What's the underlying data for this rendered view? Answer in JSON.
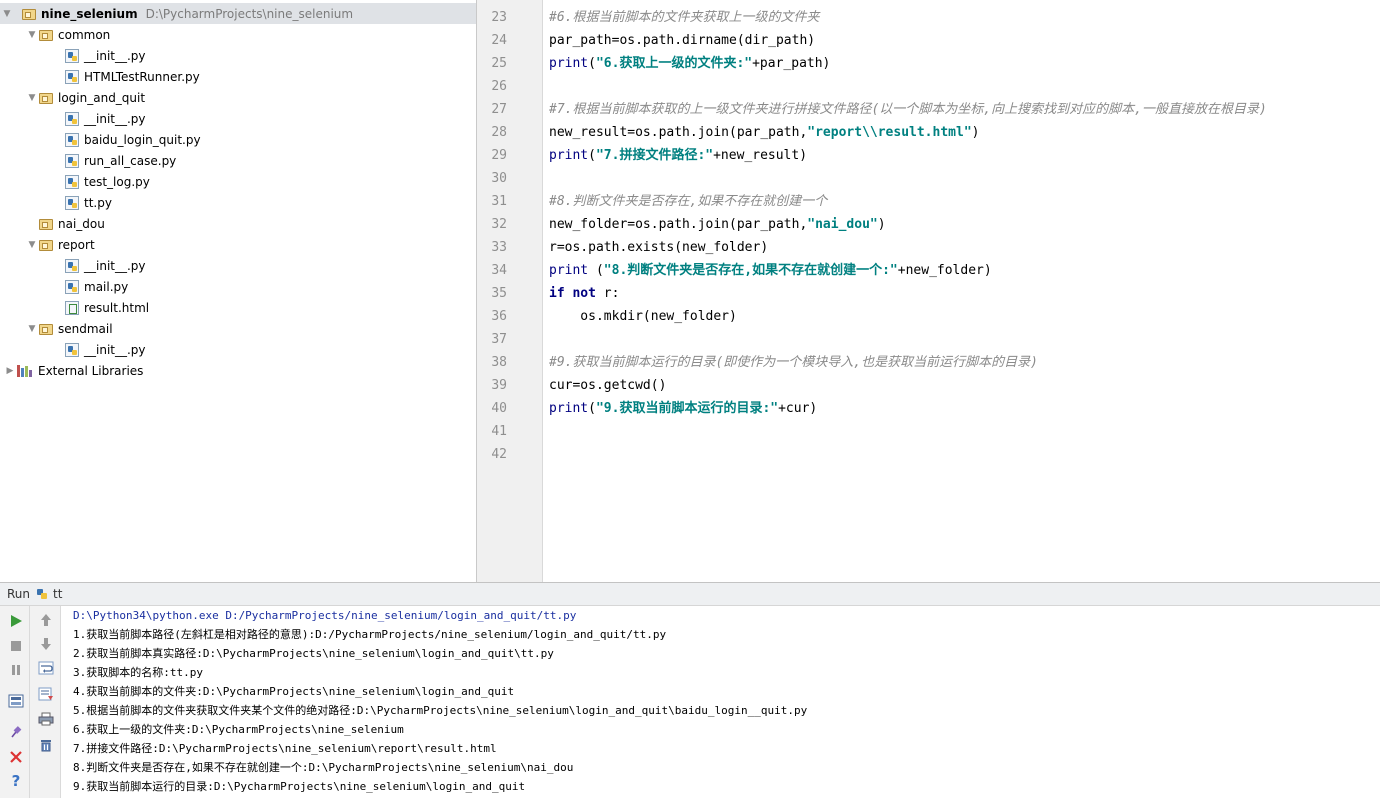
{
  "project_tree": {
    "root": {
      "name": "nine_selenium",
      "path": "D:\\PycharmProjects\\nine_selenium"
    },
    "items": [
      {
        "label": "common",
        "type": "folder",
        "depth": 1,
        "expanded": true
      },
      {
        "label": "__init__.py",
        "type": "py",
        "depth": 2
      },
      {
        "label": "HTMLTestRunner.py",
        "type": "py",
        "depth": 2
      },
      {
        "label": "login_and_quit",
        "type": "folder",
        "depth": 1,
        "expanded": true
      },
      {
        "label": "__init__.py",
        "type": "py",
        "depth": 2
      },
      {
        "label": "baidu_login_quit.py",
        "type": "py",
        "depth": 2
      },
      {
        "label": "run_all_case.py",
        "type": "py",
        "depth": 2
      },
      {
        "label": "test_log.py",
        "type": "py",
        "depth": 2
      },
      {
        "label": "tt.py",
        "type": "py",
        "depth": 2
      },
      {
        "label": "nai_dou",
        "type": "folder",
        "depth": 1,
        "expanded": false
      },
      {
        "label": "report",
        "type": "folder",
        "depth": 1,
        "expanded": true
      },
      {
        "label": "__init__.py",
        "type": "py",
        "depth": 2
      },
      {
        "label": "mail.py",
        "type": "py",
        "depth": 2
      },
      {
        "label": "result.html",
        "type": "html",
        "depth": 2
      },
      {
        "label": "sendmail",
        "type": "folder",
        "depth": 1,
        "expanded": true
      },
      {
        "label": "__init__.py",
        "type": "py",
        "depth": 2
      },
      {
        "label": "External Libraries",
        "type": "lib",
        "depth": 0,
        "expanded": false
      }
    ]
  },
  "editor": {
    "lines": [
      {
        "num": "23",
        "tokens": [
          {
            "t": "#6.根据当前脚本的文件夹获取上一级的文件夹",
            "c": "cm"
          }
        ]
      },
      {
        "num": "24",
        "tokens": [
          {
            "t": "par_path=os.path.dirname(dir_path)",
            "c": "ident"
          }
        ]
      },
      {
        "num": "25",
        "tokens": [
          {
            "t": "print",
            "c": "bi"
          },
          {
            "t": "(",
            "c": "ident"
          },
          {
            "t": "\"6.获取上一级的文件夹:\"",
            "c": "str"
          },
          {
            "t": "+par_path)",
            "c": "ident"
          }
        ]
      },
      {
        "num": "26",
        "tokens": []
      },
      {
        "num": "27",
        "tokens": [
          {
            "t": "#7.根据当前脚本获取的上一级文件夹进行拼接文件路径(以一个脚本为坐标,向上搜索找到对应的脚本,一般直接放在根目录)",
            "c": "cm"
          }
        ]
      },
      {
        "num": "28",
        "tokens": [
          {
            "t": "new_result=os.path.join(par_path,",
            "c": "ident"
          },
          {
            "t": "\"report\\\\result.html\"",
            "c": "str"
          },
          {
            "t": ")",
            "c": "ident"
          }
        ]
      },
      {
        "num": "29",
        "tokens": [
          {
            "t": "print",
            "c": "bi"
          },
          {
            "t": "(",
            "c": "ident"
          },
          {
            "t": "\"7.拼接文件路径:\"",
            "c": "str"
          },
          {
            "t": "+new_result)",
            "c": "ident"
          }
        ]
      },
      {
        "num": "30",
        "tokens": []
      },
      {
        "num": "31",
        "tokens": [
          {
            "t": "#8.判断文件夹是否存在,如果不存在就创建一个",
            "c": "cm"
          }
        ]
      },
      {
        "num": "32",
        "tokens": [
          {
            "t": "new_folder=os.path.join(par_path,",
            "c": "ident"
          },
          {
            "t": "\"nai_dou\"",
            "c": "str"
          },
          {
            "t": ")",
            "c": "ident"
          }
        ]
      },
      {
        "num": "33",
        "tokens": [
          {
            "t": "r=os.path.exists(new_folder)",
            "c": "ident"
          }
        ]
      },
      {
        "num": "34",
        "tokens": [
          {
            "t": "print",
            "c": "bi"
          },
          {
            "t": " (",
            "c": "ident"
          },
          {
            "t": "\"8.判断文件夹是否存在,如果不存在就创建一个:\"",
            "c": "str"
          },
          {
            "t": "+new_folder)",
            "c": "ident"
          }
        ]
      },
      {
        "num": "35",
        "tokens": [
          {
            "t": "if",
            "c": "kw"
          },
          {
            "t": " ",
            "c": "ident"
          },
          {
            "t": "not",
            "c": "kw"
          },
          {
            "t": " r:",
            "c": "ident"
          }
        ]
      },
      {
        "num": "36",
        "tokens": [
          {
            "t": "    os.mkdir(new_folder)",
            "c": "ident"
          }
        ]
      },
      {
        "num": "37",
        "tokens": []
      },
      {
        "num": "38",
        "tokens": [
          {
            "t": "#9.获取当前脚本运行的目录(即使作为一个模块导入,也是获取当前运行脚本的目录)",
            "c": "cm"
          }
        ]
      },
      {
        "num": "39",
        "tokens": [
          {
            "t": "cur=os.getcwd()",
            "c": "ident"
          }
        ]
      },
      {
        "num": "40",
        "tokens": [
          {
            "t": "print",
            "c": "bi"
          },
          {
            "t": "(",
            "c": "ident"
          },
          {
            "t": "\"9.获取当前脚本运行的目录:\"",
            "c": "str"
          },
          {
            "t": "+cur)",
            "c": "ident"
          }
        ]
      },
      {
        "num": "41",
        "tokens": []
      },
      {
        "num": "42",
        "tokens": []
      }
    ]
  },
  "run_panel": {
    "label": "Run",
    "tab_label": "tt",
    "output": [
      "D:\\Python34\\python.exe D:/PycharmProjects/nine_selenium/login_and_quit/tt.py",
      "1.获取当前脚本路径(左斜杠是相对路径的意思):D:/PycharmProjects/nine_selenium/login_and_quit/tt.py",
      "2.获取当前脚本真实路径:D:\\PycharmProjects\\nine_selenium\\login_and_quit\\tt.py",
      "3.获取脚本的名称:tt.py",
      "4.获取当前脚本的文件夹:D:\\PycharmProjects\\nine_selenium\\login_and_quit",
      "5.根据当前脚本的文件夹获取文件夹某个文件的绝对路径:D:\\PycharmProjects\\nine_selenium\\login_and_quit\\baidu_login__quit.py",
      "6.获取上一级的文件夹:D:\\PycharmProjects\\nine_selenium",
      "7.拼接文件路径:D:\\PycharmProjects\\nine_selenium\\report\\result.html",
      "8.判断文件夹是否存在,如果不存在就创建一个:D:\\PycharmProjects\\nine_selenium\\nai_dou",
      "9.获取当前脚本运行的目录:D:\\PycharmProjects\\nine_selenium\\login_and_quit"
    ],
    "left_toolbar_icons": [
      "rerun-icon",
      "stop-icon",
      "pause-icon",
      "layout-icon",
      "pin-icon",
      "close-icon",
      "help-icon"
    ],
    "right_toolbar_icons": [
      "scroll-up-icon",
      "scroll-down-icon",
      "soft-wrap-icon",
      "scroll-to-end-icon",
      "print-icon",
      "clear-all-icon"
    ]
  },
  "colors": {
    "comment": "#8a8a8a",
    "keyword": "#000080",
    "string": "#008080",
    "gutter": "#f0f0f0",
    "selection": "#dfe2e6",
    "command": "#1a2fa0"
  }
}
